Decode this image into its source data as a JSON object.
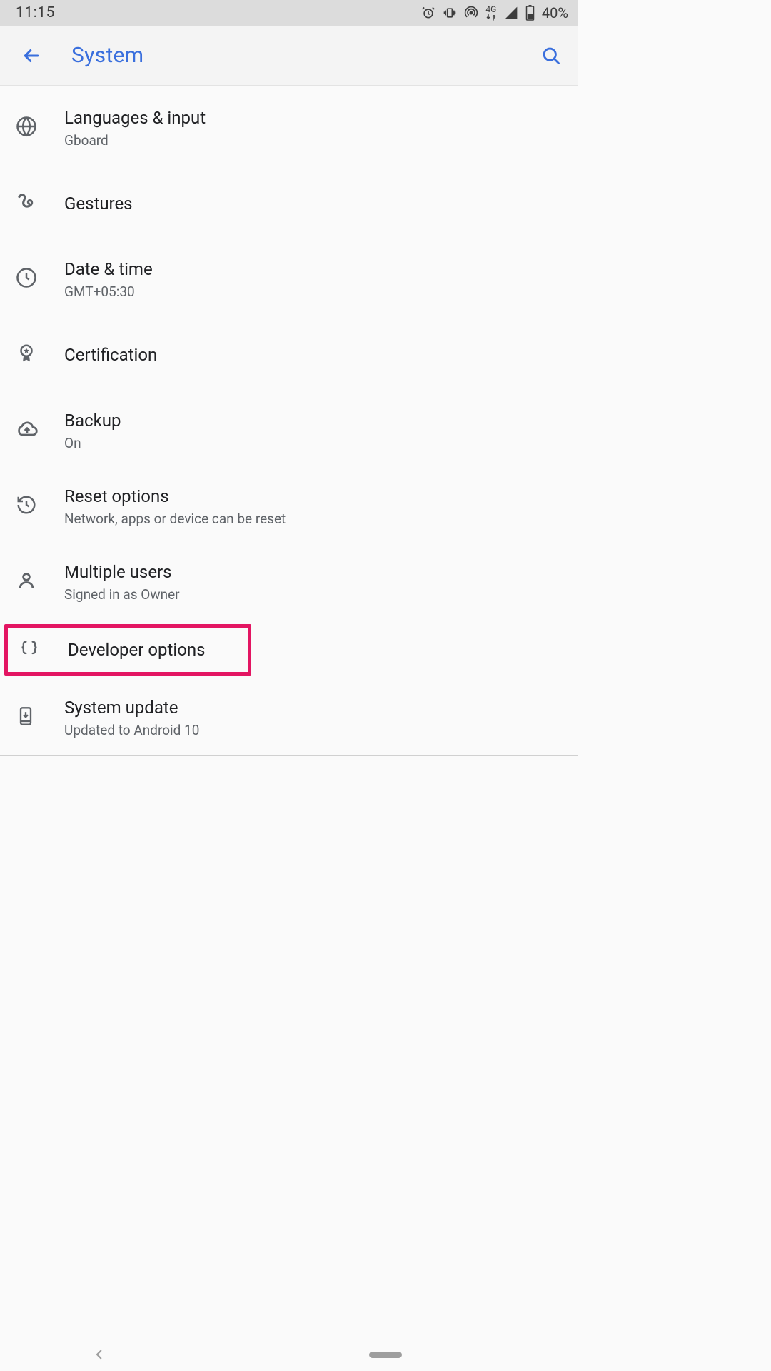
{
  "status_bar": {
    "time": "11:15",
    "network_label": "4G",
    "battery_percent": "40%"
  },
  "app_bar": {
    "title": "System"
  },
  "settings": [
    {
      "icon": "globe-icon",
      "title": "Languages & input",
      "subtitle": "Gboard"
    },
    {
      "icon": "gesture-icon",
      "title": "Gestures",
      "subtitle": ""
    },
    {
      "icon": "clock-icon",
      "title": "Date & time",
      "subtitle": "GMT+05:30"
    },
    {
      "icon": "certification-icon",
      "title": "Certification",
      "subtitle": ""
    },
    {
      "icon": "cloud-upload-icon",
      "title": "Backup",
      "subtitle": "On"
    },
    {
      "icon": "history-icon",
      "title": "Reset options",
      "subtitle": "Network, apps or device can be reset"
    },
    {
      "icon": "person-icon",
      "title": "Multiple users",
      "subtitle": "Signed in as Owner"
    },
    {
      "icon": "braces-icon",
      "title": "Developer options",
      "subtitle": "",
      "highlighted": true
    },
    {
      "icon": "system-update-icon",
      "title": "System update",
      "subtitle": "Updated to Android 10"
    }
  ]
}
